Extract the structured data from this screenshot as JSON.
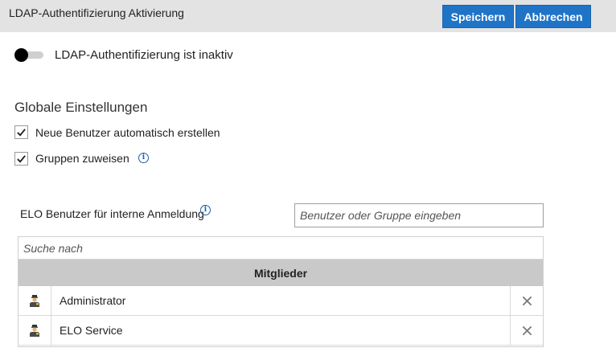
{
  "header": {
    "title": "LDAP-Authentifizierung Aktivierung",
    "save_label": "Speichern",
    "cancel_label": "Abbrechen"
  },
  "toggle": {
    "label": "LDAP-Authentifizierung ist inaktiv",
    "on": false
  },
  "global_settings": {
    "title": "Globale Einstellungen",
    "options": [
      {
        "label": "Neue Benutzer automatisch erstellen",
        "checked": true
      },
      {
        "label": "Gruppen zuweisen",
        "checked": true
      }
    ]
  },
  "internal_login": {
    "label": "ELO Benutzer für interne Anmeldung",
    "placeholder": "Benutzer oder Gruppe eingeben"
  },
  "members": {
    "search_placeholder": "Suche nach",
    "header": "Mitglieder",
    "rows": [
      {
        "name": "Administrator",
        "icon": "user-icon"
      },
      {
        "name": "ELO Service",
        "icon": "user-icon"
      }
    ]
  },
  "colors": {
    "accent": "#1f74c7",
    "header_bg": "#e3e3e3",
    "table_header_bg": "#c9c9c9",
    "info_icon": "#1f5fa8"
  }
}
